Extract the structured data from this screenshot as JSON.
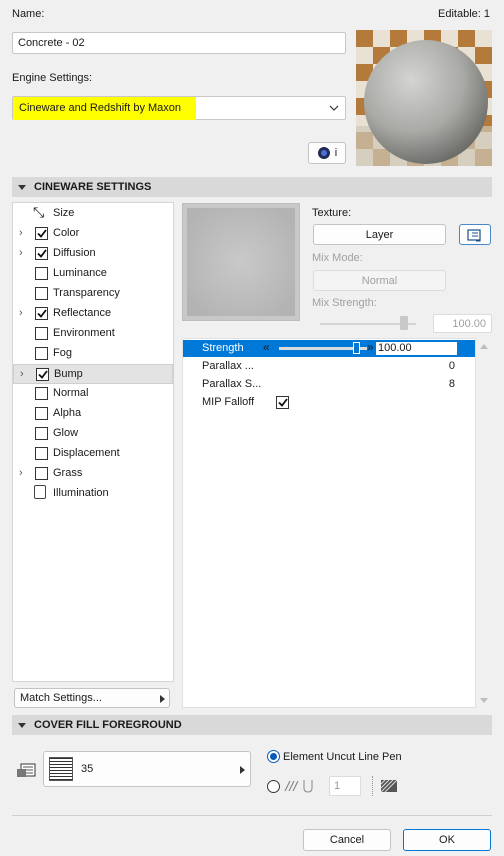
{
  "header": {
    "name_label": "Name:",
    "editable": "Editable: 1",
    "name_value": "Concrete - 02",
    "engine_label": "Engine Settings:",
    "engine_value": "Cineware and Redshift by Maxon",
    "info_btn": "i"
  },
  "cineware": {
    "title": "CINEWARE SETTINGS",
    "channels": [
      {
        "label": "Size",
        "checked": false,
        "expand": false
      },
      {
        "label": "Color",
        "checked": true,
        "expand": true
      },
      {
        "label": "Diffusion",
        "checked": true,
        "expand": true
      },
      {
        "label": "Luminance",
        "checked": false,
        "expand": false
      },
      {
        "label": "Transparency",
        "checked": false,
        "expand": false
      },
      {
        "label": "Reflectance",
        "checked": true,
        "expand": true
      },
      {
        "label": "Environment",
        "checked": false,
        "expand": false
      },
      {
        "label": "Fog",
        "checked": false,
        "expand": false
      },
      {
        "label": "Bump",
        "checked": true,
        "expand": true,
        "selected": true
      },
      {
        "label": "Normal",
        "checked": false,
        "expand": false
      },
      {
        "label": "Alpha",
        "checked": false,
        "expand": false
      },
      {
        "label": "Glow",
        "checked": false,
        "expand": false
      },
      {
        "label": "Displacement",
        "checked": false,
        "expand": false
      },
      {
        "label": "Grass",
        "checked": false,
        "expand": true
      },
      {
        "label": "Illumination",
        "checked": false,
        "expand": false
      }
    ],
    "match_settings": "Match Settings...",
    "texture_label": "Texture:",
    "layer_btn": "Layer",
    "mix_mode_label": "Mix Mode:",
    "mix_mode_value": "Normal",
    "mix_strength_label": "Mix Strength:",
    "mix_strength_value": "100.00",
    "mix_strength": 0.87,
    "strength_label": "Strength",
    "strength_value": "100.00",
    "strength": 0.88,
    "props": [
      {
        "label": "Parallax ...",
        "value": "0"
      },
      {
        "label": "Parallax S...",
        "value": "8"
      }
    ],
    "mip_label": "MIP Falloff",
    "mip_checked": true
  },
  "cover": {
    "title": "COVER FILL FOREGROUND",
    "fill_value": "35",
    "pen_label": "Element Uncut Line Pen",
    "pen_number": "1"
  },
  "footer": {
    "cancel": "Cancel",
    "ok": "OK"
  },
  "colors": {
    "highlight": "#ffff00",
    "selection": "#0078d7"
  }
}
